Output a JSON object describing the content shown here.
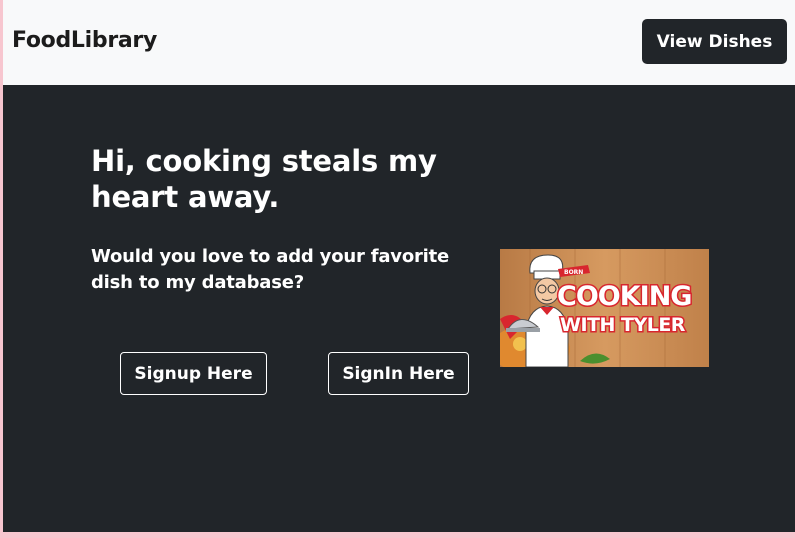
{
  "navbar": {
    "brand": "FoodLibrary",
    "view_dishes_label": "View Dishes"
  },
  "hero": {
    "title": "Hi, cooking steals my heart away.",
    "subtitle": "Would you love to add your favorite dish to my database?",
    "signup_label": "Signup Here",
    "signin_label": "SignIn Here"
  },
  "promo_image": {
    "badge": "BORN",
    "title_line1": "COOKING",
    "title_line2": "WITH TYLER"
  },
  "colors": {
    "navbar_bg": "#f8f9fa",
    "hero_bg": "#212529",
    "button_dark": "#212529",
    "page_border": "#f7c6cf",
    "promo_red": "#d8262e",
    "promo_wood": "#c98a52"
  }
}
